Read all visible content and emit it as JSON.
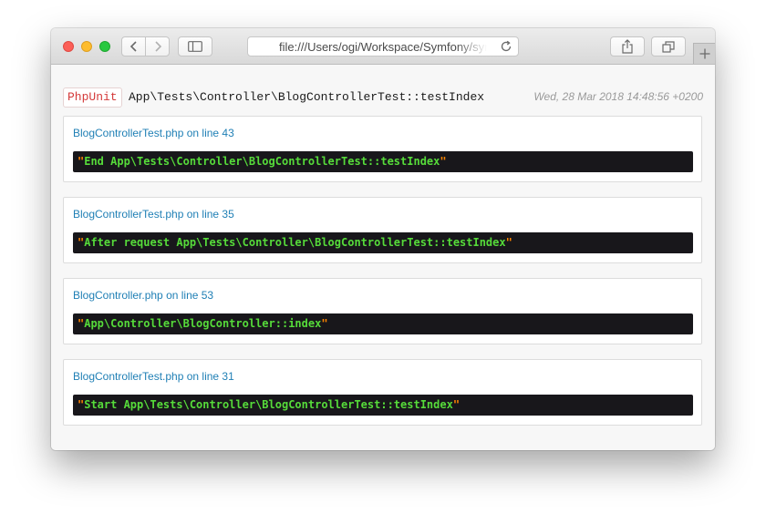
{
  "browser": {
    "url": "file:///Users/ogi/Workspace/Symfony/symfony-demo/var/cache/dev/dump.html"
  },
  "header": {
    "badge": "PhpUnit",
    "test_name": "App\\Tests\\Controller\\BlogControllerTest::testIndex",
    "timestamp": "Wed, 28 Mar 2018 14:48:56 +0200"
  },
  "dumps": [
    {
      "location": "BlogControllerTest.php on line 43",
      "value": "End App\\Tests\\Controller\\BlogControllerTest::testIndex"
    },
    {
      "location": "BlogControllerTest.php on line 35",
      "value": "After request App\\Tests\\Controller\\BlogControllerTest::testIndex"
    },
    {
      "location": "BlogController.php on line 53",
      "value": "App\\Controller\\BlogController::index"
    },
    {
      "location": "BlogControllerTest.php on line 31",
      "value": "Start App\\Tests\\Controller\\BlogControllerTest::testIndex"
    }
  ],
  "icons": {
    "close": "close-window-icon",
    "minimize": "minimize-window-icon",
    "maximize": "maximize-window-icon",
    "back": "chevron-left-icon",
    "forward": "chevron-right-icon",
    "sidebar": "sidebar-icon",
    "reload": "reload-icon",
    "share": "share-icon",
    "tabs": "tabs-overview-icon",
    "new_tab": "plus-icon"
  },
  "colors": {
    "badge_text": "#d43a3a",
    "link": "#1f7fb5",
    "dump_bg": "#18171b",
    "dump_string": "#56db3a",
    "dump_quote": "#ff8400"
  }
}
